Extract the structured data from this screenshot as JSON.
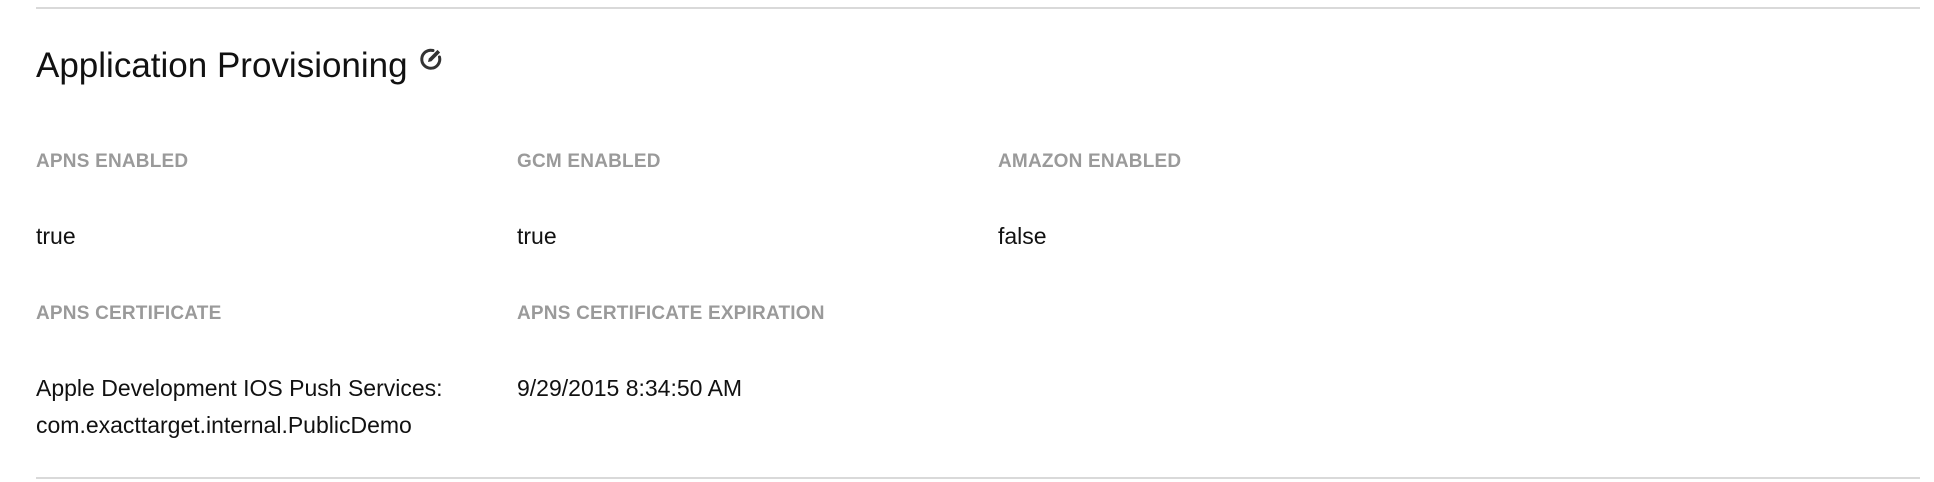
{
  "section": {
    "title": "Application Provisioning",
    "edit_icon": "edit-icon"
  },
  "fields": {
    "apns_enabled": {
      "label": "APNS ENABLED",
      "value": "true"
    },
    "gcm_enabled": {
      "label": "GCM ENABLED",
      "value": "true"
    },
    "amazon_enabled": {
      "label": "AMAZON ENABLED",
      "value": "false"
    },
    "apns_certificate": {
      "label": "APNS CERTIFICATE",
      "value_line1": "Apple Development IOS Push Services:",
      "value_line2": "com.exacttarget.internal.PublicDemo"
    },
    "apns_certificate_expiration": {
      "label": "APNS CERTIFICATE EXPIRATION",
      "value": "9/29/2015 8:34:50 AM"
    }
  },
  "colors": {
    "label": "#9a9a9a",
    "text": "#111111",
    "divider": "#d9d9d9"
  }
}
